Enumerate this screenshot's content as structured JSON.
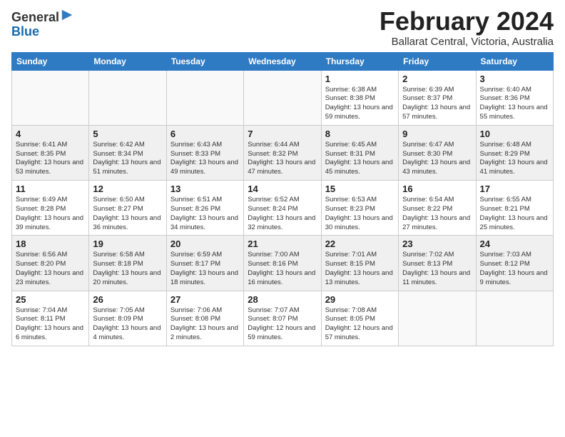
{
  "logo": {
    "general": "General",
    "blue": "Blue"
  },
  "title": "February 2024",
  "subtitle": "Ballarat Central, Victoria, Australia",
  "days_of_week": [
    "Sunday",
    "Monday",
    "Tuesday",
    "Wednesday",
    "Thursday",
    "Friday",
    "Saturday"
  ],
  "weeks": [
    [
      {
        "day": "",
        "info": ""
      },
      {
        "day": "",
        "info": ""
      },
      {
        "day": "",
        "info": ""
      },
      {
        "day": "",
        "info": ""
      },
      {
        "day": "1",
        "info": "Sunrise: 6:38 AM\nSunset: 8:38 PM\nDaylight: 13 hours and 59 minutes."
      },
      {
        "day": "2",
        "info": "Sunrise: 6:39 AM\nSunset: 8:37 PM\nDaylight: 13 hours and 57 minutes."
      },
      {
        "day": "3",
        "info": "Sunrise: 6:40 AM\nSunset: 8:36 PM\nDaylight: 13 hours and 55 minutes."
      }
    ],
    [
      {
        "day": "4",
        "info": "Sunrise: 6:41 AM\nSunset: 8:35 PM\nDaylight: 13 hours and 53 minutes."
      },
      {
        "day": "5",
        "info": "Sunrise: 6:42 AM\nSunset: 8:34 PM\nDaylight: 13 hours and 51 minutes."
      },
      {
        "day": "6",
        "info": "Sunrise: 6:43 AM\nSunset: 8:33 PM\nDaylight: 13 hours and 49 minutes."
      },
      {
        "day": "7",
        "info": "Sunrise: 6:44 AM\nSunset: 8:32 PM\nDaylight: 13 hours and 47 minutes."
      },
      {
        "day": "8",
        "info": "Sunrise: 6:45 AM\nSunset: 8:31 PM\nDaylight: 13 hours and 45 minutes."
      },
      {
        "day": "9",
        "info": "Sunrise: 6:47 AM\nSunset: 8:30 PM\nDaylight: 13 hours and 43 minutes."
      },
      {
        "day": "10",
        "info": "Sunrise: 6:48 AM\nSunset: 8:29 PM\nDaylight: 13 hours and 41 minutes."
      }
    ],
    [
      {
        "day": "11",
        "info": "Sunrise: 6:49 AM\nSunset: 8:28 PM\nDaylight: 13 hours and 39 minutes."
      },
      {
        "day": "12",
        "info": "Sunrise: 6:50 AM\nSunset: 8:27 PM\nDaylight: 13 hours and 36 minutes."
      },
      {
        "day": "13",
        "info": "Sunrise: 6:51 AM\nSunset: 8:26 PM\nDaylight: 13 hours and 34 minutes."
      },
      {
        "day": "14",
        "info": "Sunrise: 6:52 AM\nSunset: 8:24 PM\nDaylight: 13 hours and 32 minutes."
      },
      {
        "day": "15",
        "info": "Sunrise: 6:53 AM\nSunset: 8:23 PM\nDaylight: 13 hours and 30 minutes."
      },
      {
        "day": "16",
        "info": "Sunrise: 6:54 AM\nSunset: 8:22 PM\nDaylight: 13 hours and 27 minutes."
      },
      {
        "day": "17",
        "info": "Sunrise: 6:55 AM\nSunset: 8:21 PM\nDaylight: 13 hours and 25 minutes."
      }
    ],
    [
      {
        "day": "18",
        "info": "Sunrise: 6:56 AM\nSunset: 8:20 PM\nDaylight: 13 hours and 23 minutes."
      },
      {
        "day": "19",
        "info": "Sunrise: 6:58 AM\nSunset: 8:18 PM\nDaylight: 13 hours and 20 minutes."
      },
      {
        "day": "20",
        "info": "Sunrise: 6:59 AM\nSunset: 8:17 PM\nDaylight: 13 hours and 18 minutes."
      },
      {
        "day": "21",
        "info": "Sunrise: 7:00 AM\nSunset: 8:16 PM\nDaylight: 13 hours and 16 minutes."
      },
      {
        "day": "22",
        "info": "Sunrise: 7:01 AM\nSunset: 8:15 PM\nDaylight: 13 hours and 13 minutes."
      },
      {
        "day": "23",
        "info": "Sunrise: 7:02 AM\nSunset: 8:13 PM\nDaylight: 13 hours and 11 minutes."
      },
      {
        "day": "24",
        "info": "Sunrise: 7:03 AM\nSunset: 8:12 PM\nDaylight: 13 hours and 9 minutes."
      }
    ],
    [
      {
        "day": "25",
        "info": "Sunrise: 7:04 AM\nSunset: 8:11 PM\nDaylight: 13 hours and 6 minutes."
      },
      {
        "day": "26",
        "info": "Sunrise: 7:05 AM\nSunset: 8:09 PM\nDaylight: 13 hours and 4 minutes."
      },
      {
        "day": "27",
        "info": "Sunrise: 7:06 AM\nSunset: 8:08 PM\nDaylight: 13 hours and 2 minutes."
      },
      {
        "day": "28",
        "info": "Sunrise: 7:07 AM\nSunset: 8:07 PM\nDaylight: 12 hours and 59 minutes."
      },
      {
        "day": "29",
        "info": "Sunrise: 7:08 AM\nSunset: 8:05 PM\nDaylight: 12 hours and 57 minutes."
      },
      {
        "day": "",
        "info": ""
      },
      {
        "day": "",
        "info": ""
      }
    ]
  ]
}
